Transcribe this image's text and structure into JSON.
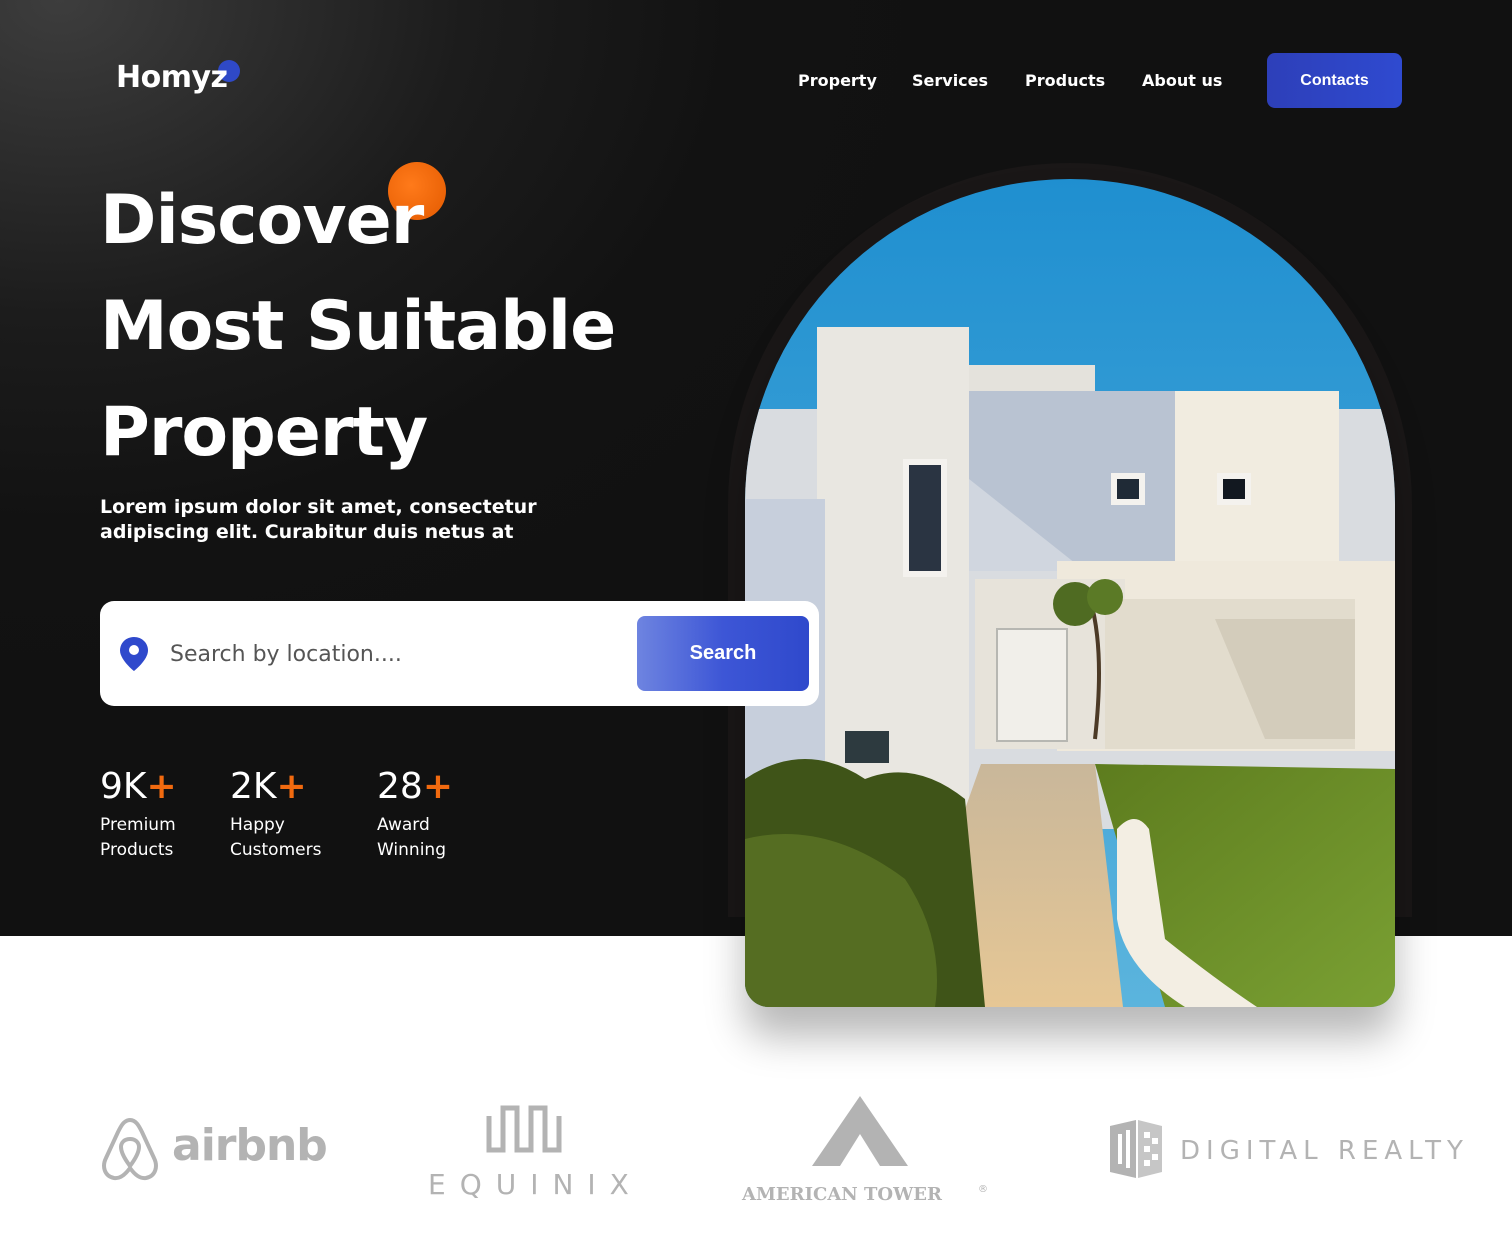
{
  "brand": {
    "name": "Homyz",
    "accent": "#2f49c7",
    "orange": "#f26a0f"
  },
  "nav": {
    "items": [
      {
        "label": "Property"
      },
      {
        "label": "Services"
      },
      {
        "label": "Products"
      },
      {
        "label": "About us"
      }
    ],
    "cta_label": "Contacts"
  },
  "hero": {
    "headline": [
      "Discover",
      "Most Suitable",
      "Property"
    ],
    "subtitle": "Lorem ipsum dolor sit amet, consectetur adipiscing elit. Curabitur duis netus at"
  },
  "search": {
    "placeholder": "Search by location....",
    "button_label": "Search",
    "icon": "location-pin-icon"
  },
  "stats": [
    {
      "value": "9K",
      "plus": "+",
      "label": "Premium Products"
    },
    {
      "value": "2K",
      "plus": "+",
      "label": "Happy Customers"
    },
    {
      "value": "28",
      "plus": "+",
      "label": "Award Winning"
    }
  ],
  "partners": [
    {
      "name": "airbnb"
    },
    {
      "name": "EQUINIX"
    },
    {
      "name": "AMERICAN TOWER",
      "mark": "®"
    },
    {
      "name": "DIGITAL REALTY"
    }
  ]
}
